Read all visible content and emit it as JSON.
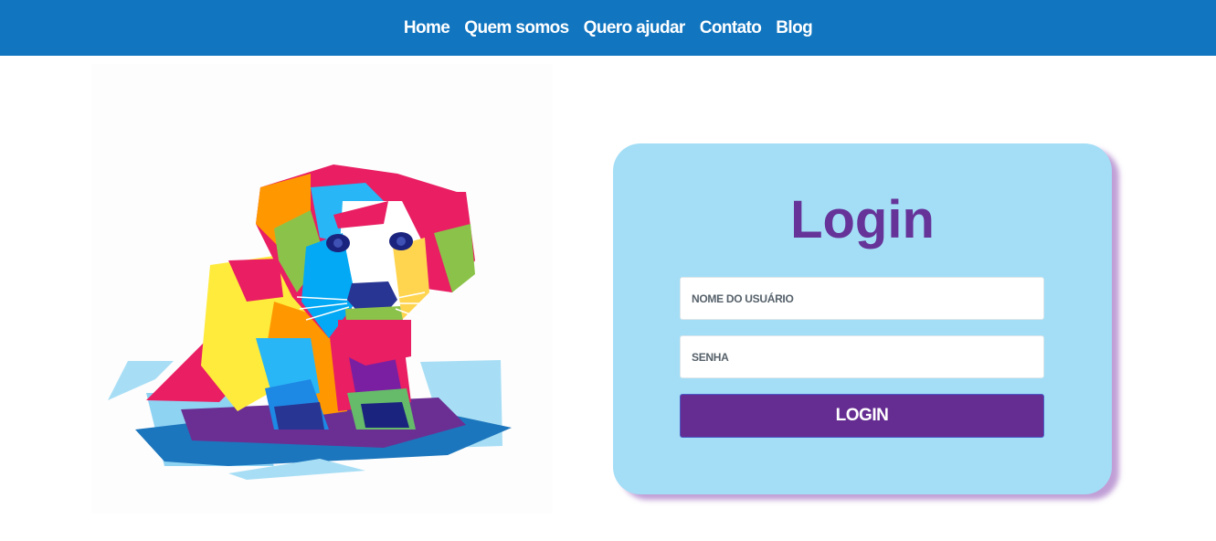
{
  "nav": {
    "items": [
      {
        "label": "Home"
      },
      {
        "label": "Quem somos"
      },
      {
        "label": "Quero ajudar"
      },
      {
        "label": "Contato"
      },
      {
        "label": "Blog"
      }
    ]
  },
  "login": {
    "title": "Login",
    "username_placeholder": "NOME DO USUÁRIO",
    "password_placeholder": "SENHA",
    "button_label": "LOGIN"
  },
  "colors": {
    "navbar": "#1175bf",
    "card": "#a3def6",
    "accent": "#652d91",
    "title": "#663399"
  },
  "hero": {
    "illustration": "colorful-geometric-puppy"
  }
}
